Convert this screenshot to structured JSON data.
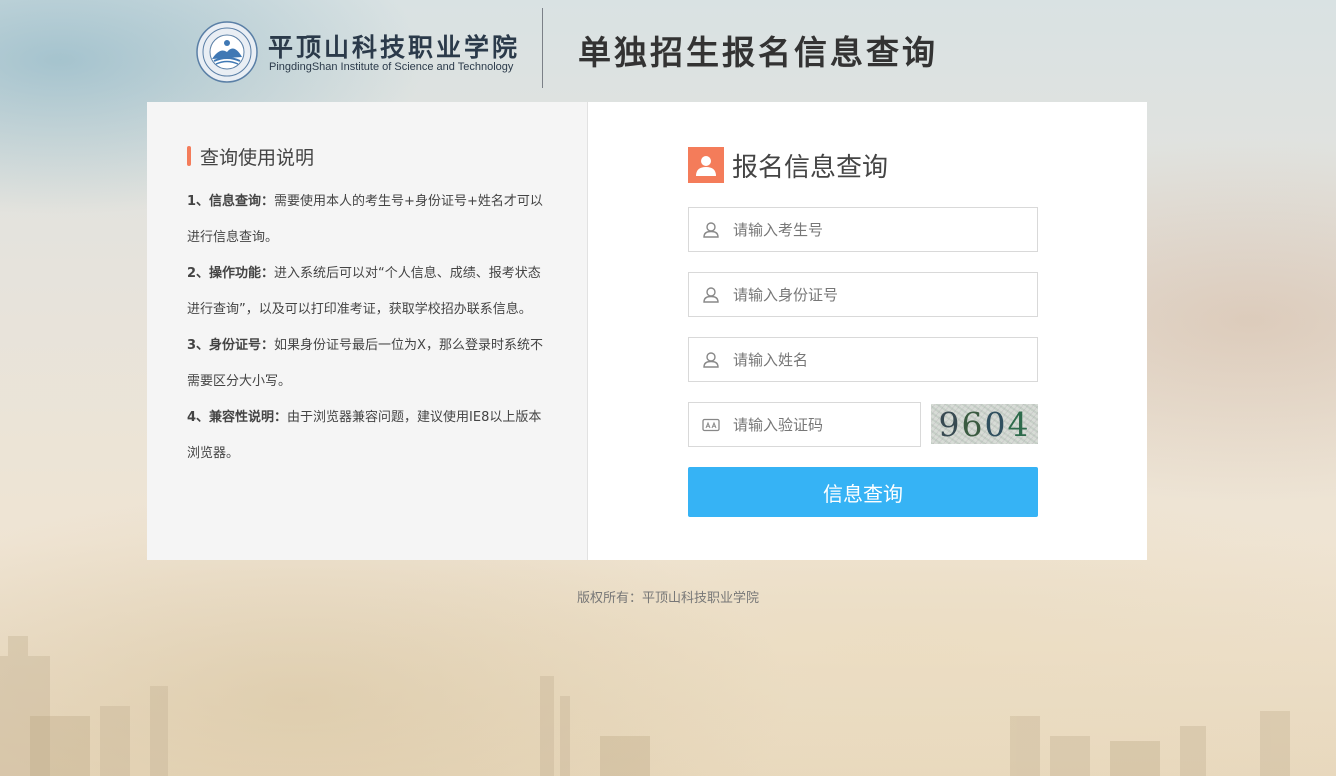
{
  "header": {
    "school_name_cn": "平顶山科技职业学院",
    "school_name_en": "PingdingShan Institute of Science and Technology",
    "page_title": "单独招生报名信息查询"
  },
  "instructions": {
    "title": "查询使用说明",
    "items": [
      {
        "key": "1、信息查询：",
        "text": "需要使用本人的考生号+身份证号+姓名才可以进行信息查询。"
      },
      {
        "key": "2、操作功能：",
        "text": "进入系统后可以对“个人信息、成绩、报考状态进行查询”，以及可以打印准考证，获取学校招办联系信息。"
      },
      {
        "key": "3、身份证号：",
        "text": "如果身份证号最后一位为X，那么登录时系统不需要区分大小写。"
      },
      {
        "key": "4、兼容性说明：",
        "text": "由于浏览器兼容问题，建议使用IE8以上版本浏览器。"
      }
    ]
  },
  "form": {
    "title": "报名信息查询",
    "exam_number_placeholder": "请输入考生号",
    "id_number_placeholder": "请输入身份证号",
    "name_placeholder": "请输入姓名",
    "captcha_placeholder": "请输入验证码",
    "captcha_digits": [
      "9",
      "6",
      "0",
      "4"
    ],
    "submit_label": "信息查询"
  },
  "footer": {
    "copyright": "版权所有：平顶山科技职业学院"
  },
  "colors": {
    "accent_orange": "#f47c5a",
    "button_blue": "#36b3f5"
  }
}
